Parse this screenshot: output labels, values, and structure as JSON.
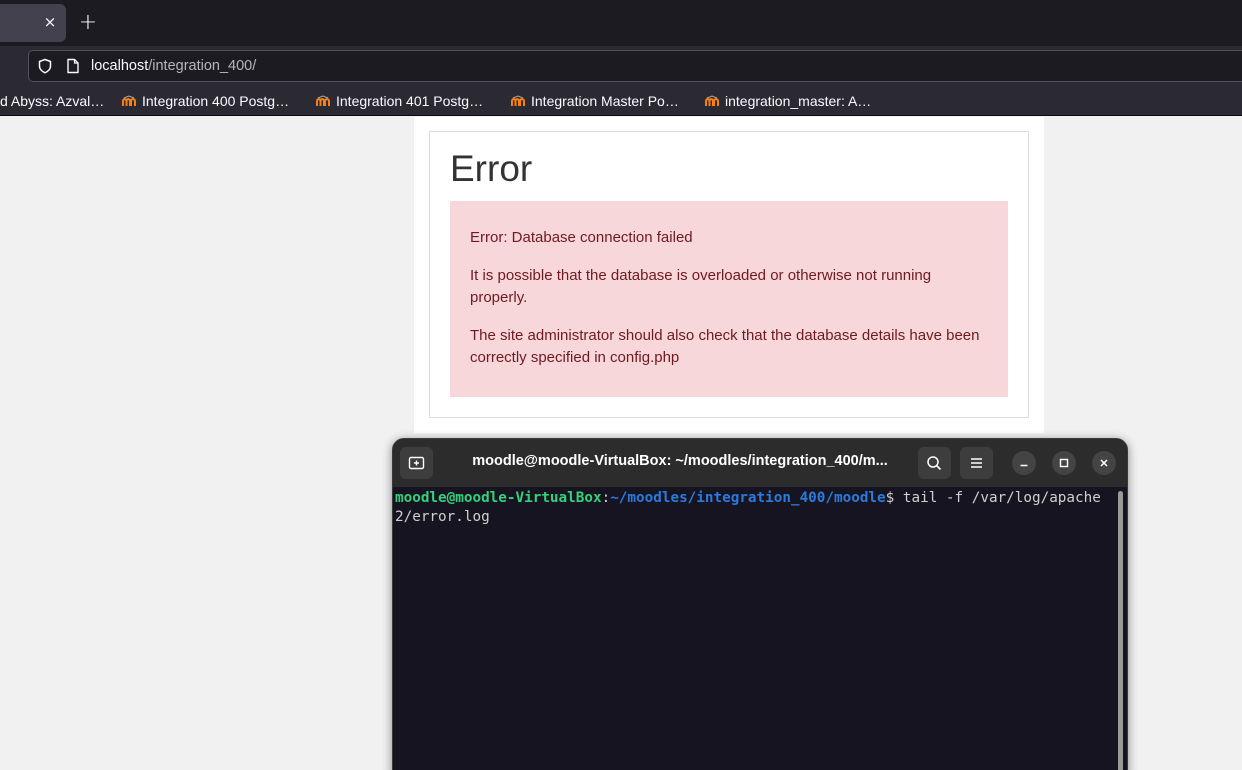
{
  "browser": {
    "tab": {
      "close_glyph": "×"
    },
    "new_tab_glyph": "+",
    "url": {
      "host": "localhost",
      "path": "/integration_400/"
    },
    "bookmarks": [
      {
        "label": "d Abyss: Azval…",
        "icon": ""
      },
      {
        "label": "Integration 400 Postg…",
        "icon": "moodle-icon"
      },
      {
        "label": "Integration 401 Postg…",
        "icon": "moodle-icon"
      },
      {
        "label": "Integration Master Po…",
        "icon": "moodle-icon"
      },
      {
        "label": "integration_master: A…",
        "icon": "moodle-icon"
      }
    ]
  },
  "page": {
    "title": "Error",
    "alert": {
      "line1": "Error: Database connection failed",
      "line2": "It is possible that the database is overloaded or otherwise not running properly.",
      "line3": "The site administrator should also check that the database details have been correctly specified in config.php"
    }
  },
  "terminal": {
    "title": "moodle@moodle-VirtualBox: ~/moodles/integration_400/m...",
    "prompt_user": "moodle@moodle-VirtualBox",
    "prompt_sep": ":",
    "prompt_path": "~/moodles/integration_400/moodle",
    "prompt_end": "$ ",
    "command": "tail -f /var/log/apache2/error.log"
  },
  "colors": {
    "alert_bg": "#f8d7da",
    "alert_text": "#6e1a20",
    "prompt_user": "#33d17a",
    "prompt_path": "#2a7bde",
    "terminal_bg": "#171421"
  }
}
